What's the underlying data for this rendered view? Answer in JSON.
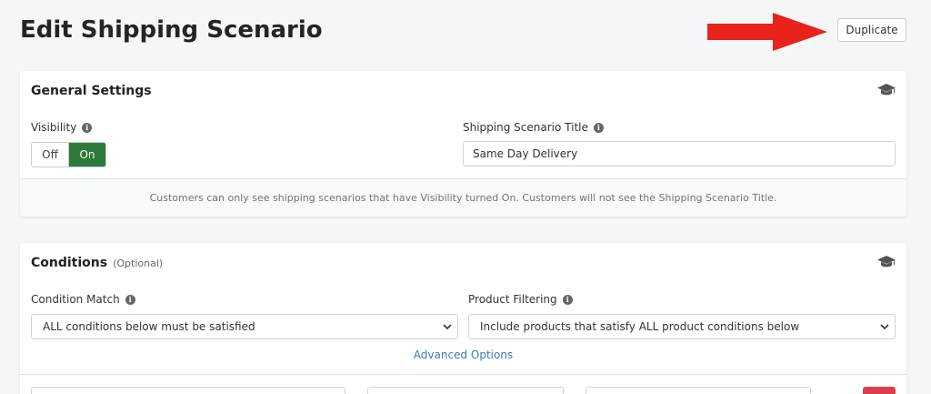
{
  "page": {
    "title": "Edit Shipping Scenario",
    "duplicate_label": "Duplicate"
  },
  "general": {
    "title": "General Settings",
    "visibility_label": "Visibility",
    "toggle_off": "Off",
    "toggle_on": "On",
    "toggle_value": "On",
    "scenario_title_label": "Shipping Scenario Title",
    "scenario_title_value": "Same Day Delivery",
    "note": "Customers can only see shipping scenarios that have Visibility turned On. Customers will not see the Shipping Scenario Title."
  },
  "conditions": {
    "title": "Conditions",
    "optional": "(Optional)",
    "condition_match_label": "Condition Match",
    "condition_match_value": "ALL conditions below must be satisfied",
    "product_filtering_label": "Product Filtering",
    "product_filtering_value": "Include products that satisfy ALL product conditions below",
    "advanced_options": "Advanced Options"
  },
  "colors": {
    "toggle_on": "#2d7a3a",
    "arrow": "#e8231b",
    "link": "#3a7bb5",
    "delete": "#d9404f"
  },
  "icons": {
    "info": "info-circle-icon",
    "help": "graduation-cap-icon",
    "chevron": "chevron-down-icon",
    "arrow": "right-arrow-icon"
  }
}
